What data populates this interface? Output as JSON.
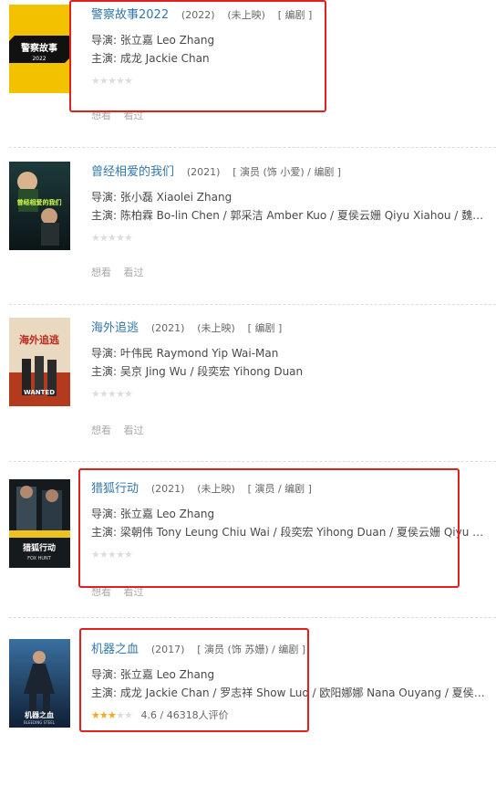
{
  "movies": [
    {
      "title": "警察故事2022",
      "year": "(2022)",
      "status": "(未上映)",
      "roles": "[ 编剧 ]",
      "director": "导演: 张立嘉 Leo Zhang",
      "cast": "主演: 成龙 Jackie Chan",
      "rating": "",
      "actions": [
        "想看",
        "看过"
      ],
      "poster_text": "警察故事",
      "poster_subtext": "2022"
    },
    {
      "title": "曾经相爱的我们",
      "year": "(2021)",
      "status": "",
      "roles": "[ 演员 (饰 小爱) / 编剧 ]",
      "director": "导演: 张小磊 Xiaolei Zhang",
      "cast": "主演: 陈柏霖 Bo-lin Chen / 郭采洁 Amber Kuo / 夏侯云姗 Qiyu Xiahou / 魏巡 Xun ...",
      "rating": "",
      "actions": [
        "想看",
        "看过"
      ],
      "poster_text": "曾经相爱的我们",
      "poster_subtext": ""
    },
    {
      "title": "海外追逃",
      "year": "(2021)",
      "status": "(未上映)",
      "roles": "[ 编剧 ]",
      "director": "导演: 叶伟民 Raymond Yip Wai-Man",
      "cast": "主演: 吴京 Jing Wu / 段奕宏 Yihong Duan",
      "rating": "",
      "actions": [
        "想看",
        "看过"
      ],
      "poster_text": "海外追逃",
      "poster_subtext": "WANTED"
    },
    {
      "title": "猎狐行动",
      "year": "(2021)",
      "status": "(未上映)",
      "roles": "[ 演员 / 编剧 ]",
      "director": "导演: 张立嘉 Leo Zhang",
      "cast": "主演: 梁朝伟 Tony Leung Chiu Wai / 段奕宏 Yihong Duan / 夏侯云姗 Qiyu Xiahou / ...",
      "rating": "",
      "actions": [
        "想看",
        "看过"
      ],
      "poster_text": "猎狐行动",
      "poster_subtext": "FOX HUNT"
    },
    {
      "title": "机器之血",
      "year": "(2017)",
      "status": "",
      "roles": "[ 演员 (饰 苏姗) / 编剧 ]",
      "director": "导演: 张立嘉 Leo Zhang",
      "cast": "主演: 成龙 Jackie Chan / 罗志祥 Show Luo / 欧阳娜娜 Nana Ouyang / 夏侯琪誉 Qiy...",
      "rating": "4.6 / 46318人评价",
      "stars_filled": 2.5,
      "actions": [],
      "poster_text": "机器之血",
      "poster_subtext": "BLEEDING STEEL"
    }
  ],
  "colors": {
    "title_link": "#3377aa",
    "star_on": "#f6a623",
    "star_off": "#dddddd",
    "highlight": "#e02020"
  }
}
